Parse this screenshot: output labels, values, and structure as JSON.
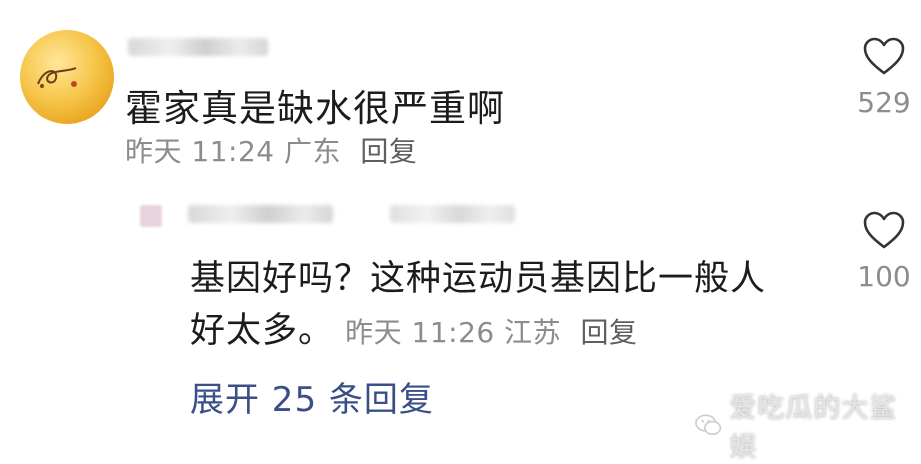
{
  "top_comment": {
    "text": "霍家真是缺水很严重啊",
    "time": "昨天 11:24",
    "location": "广东",
    "reply_label": "回复",
    "likes": "529"
  },
  "reply_comment": {
    "text_line1": "基因好吗？这种运动员基因比一般人",
    "text_line2": "好太多。",
    "time": "昨天 11:26",
    "location": "江苏",
    "reply_label": "回复",
    "likes": "100"
  },
  "expand_replies": "展开 25 条回复",
  "watermark": "爱吃瓜的大鲨娱",
  "colors": {
    "text_primary": "#1c1c1c",
    "text_meta": "#8c8c8c",
    "link_blue": "#3a4f87"
  },
  "icons": [
    "heart-outline-icon",
    "wechat-logo-icon"
  ]
}
